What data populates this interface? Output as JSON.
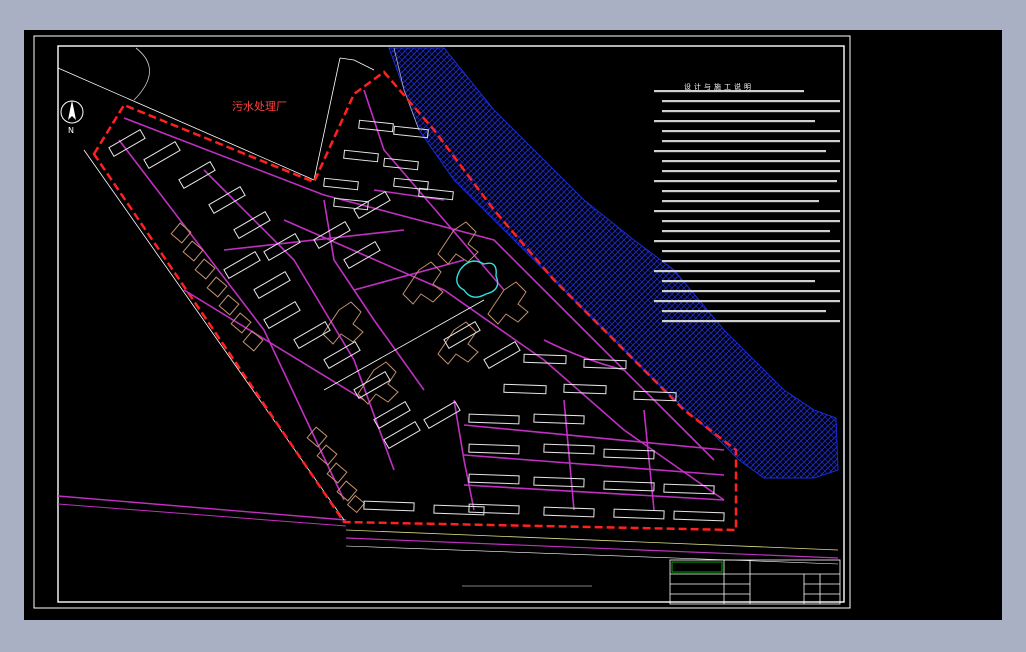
{
  "drawing": {
    "plant_label": "污水处理厂",
    "notes_title": "设计与施工说明",
    "north_label": "N",
    "colors": {
      "background": "#000000",
      "frame": "#ffffff",
      "redline": "#ff2020",
      "roads": "#c030c0",
      "buildings": "#e8e8e8",
      "river": "#1a2bd8",
      "towers": "#c09070",
      "title_block_green": "#00cc00"
    }
  }
}
